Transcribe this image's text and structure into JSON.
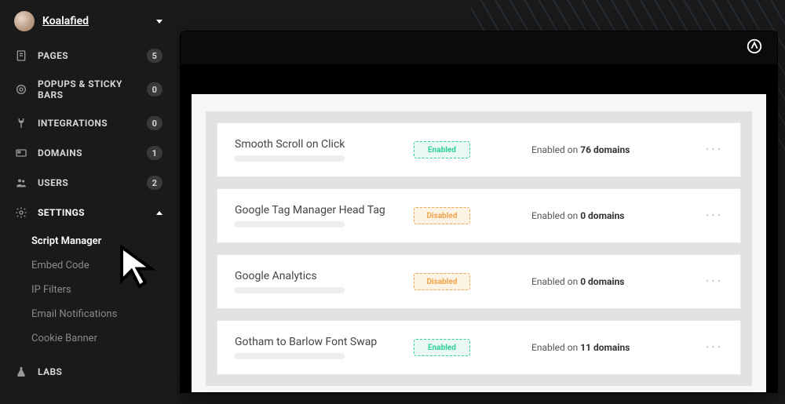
{
  "user": {
    "name": "Koalafied"
  },
  "nav": [
    {
      "icon": "page",
      "label": "PAGES",
      "count": "5"
    },
    {
      "icon": "target",
      "label": "POPUPS & STICKY BARS",
      "count": "0"
    },
    {
      "icon": "plug",
      "label": "INTEGRATIONS",
      "count": "0"
    },
    {
      "icon": "domain",
      "label": "DOMAINS",
      "count": "1"
    },
    {
      "icon": "users",
      "label": "USERS",
      "count": "2"
    }
  ],
  "settings": {
    "label": "SETTINGS",
    "items": [
      {
        "label": "Script Manager",
        "active": true
      },
      {
        "label": "Embed Code"
      },
      {
        "label": "IP Filters"
      },
      {
        "label": "Email Notifications"
      },
      {
        "label": "Cookie Banner"
      }
    ]
  },
  "labs": {
    "label": "LABS"
  },
  "scripts": [
    {
      "name": "Smooth Scroll on Click",
      "status": "Enabled",
      "status_type": "enabled",
      "domain_prefix": "Enabled on ",
      "domain_count": "76 domains"
    },
    {
      "name": "Google Tag Manager Head Tag",
      "status": "Disabled",
      "status_type": "disabled",
      "domain_prefix": "Enabled on ",
      "domain_count": "0 domains"
    },
    {
      "name": "Google Analytics",
      "status": "Disabled",
      "status_type": "disabled",
      "domain_prefix": "Enabled on ",
      "domain_count": "0 domains"
    },
    {
      "name": "Gotham to Barlow Font Swap",
      "status": "Enabled",
      "status_type": "enabled",
      "domain_prefix": "Enabled on ",
      "domain_count": "11 domains"
    }
  ]
}
